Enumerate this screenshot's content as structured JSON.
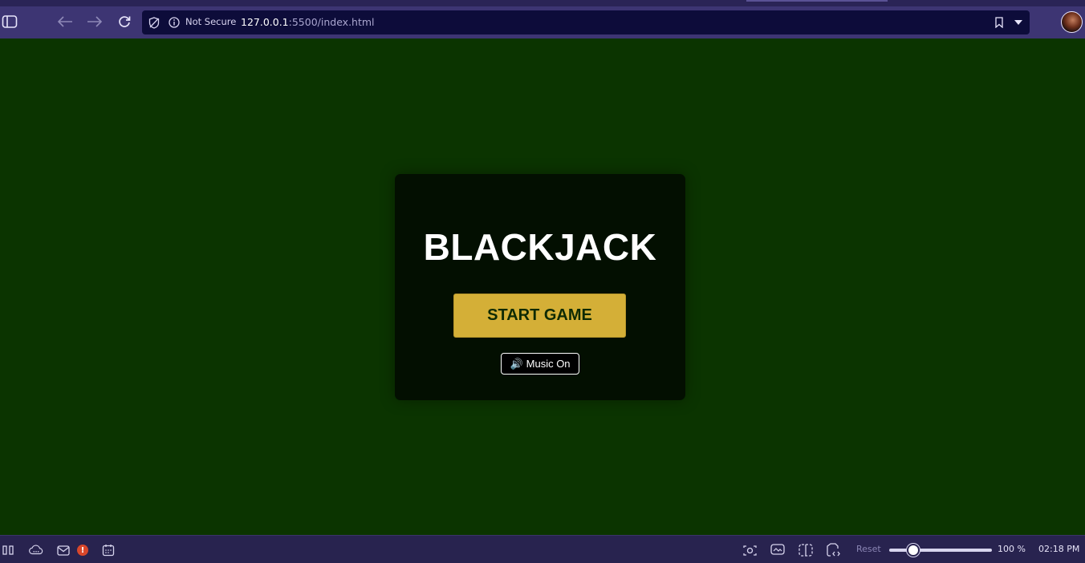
{
  "browser": {
    "security_label": "Not Secure",
    "url_host": "127.0.0.1",
    "url_path": ":5500/index.html",
    "icons": [
      "sidebar-toggle-icon",
      "back-arrow-icon",
      "forward-arrow-icon",
      "reload-icon",
      "shield-off-icon",
      "info-icon",
      "bookmark-icon",
      "dropdown-icon",
      "profile-avatar"
    ]
  },
  "game": {
    "title": "BLACKJACK",
    "start_label": "START GAME",
    "music_icon": "🔊",
    "music_label": "Music On",
    "colors": {
      "table": "#0b3400",
      "card": "#030f01",
      "accent": "#d4af37"
    }
  },
  "statusbar": {
    "badge_count": "!",
    "reset_label": "Reset",
    "zoom_percent": 100,
    "zoom_label": "100 %",
    "time": "02:18 PM",
    "icons": [
      "panel-icon",
      "cloud-icon",
      "mail-icon",
      "calendar-icon",
      "capture-icon",
      "screen-icon",
      "split-view-icon",
      "devtools-icon"
    ]
  }
}
